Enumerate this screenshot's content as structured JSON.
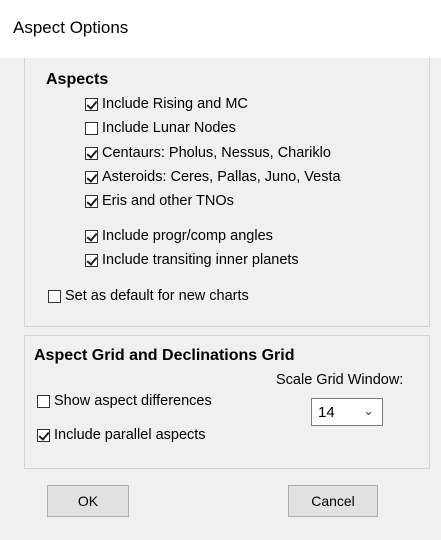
{
  "window": {
    "title": "Aspect Options"
  },
  "aspects": {
    "heading": "Aspects",
    "items": [
      {
        "label": "Include Rising and MC",
        "checked": true
      },
      {
        "label": "Include Lunar Nodes",
        "checked": false
      },
      {
        "label": "Centaurs: Pholus, Nessus, Chariklo",
        "checked": true
      },
      {
        "label": "Asteroids: Ceres, Pallas, Juno, Vesta",
        "checked": true
      },
      {
        "label": " Eris and other TNOs",
        "checked": true
      },
      {
        "label": "Include progr/comp angles",
        "checked": true
      },
      {
        "label": "Include transiting inner planets",
        "checked": true
      }
    ],
    "default_label": "Set as default for new charts",
    "default_checked": false
  },
  "grid": {
    "heading": "Aspect Grid and Declinations Grid",
    "show_diff_label": "Show aspect differences",
    "show_diff_checked": false,
    "parallel_label": "Include parallel aspects",
    "parallel_checked": true,
    "scale_label": "Scale Grid Window:",
    "scale_value": "14"
  },
  "buttons": {
    "ok": "OK",
    "cancel": "Cancel"
  }
}
